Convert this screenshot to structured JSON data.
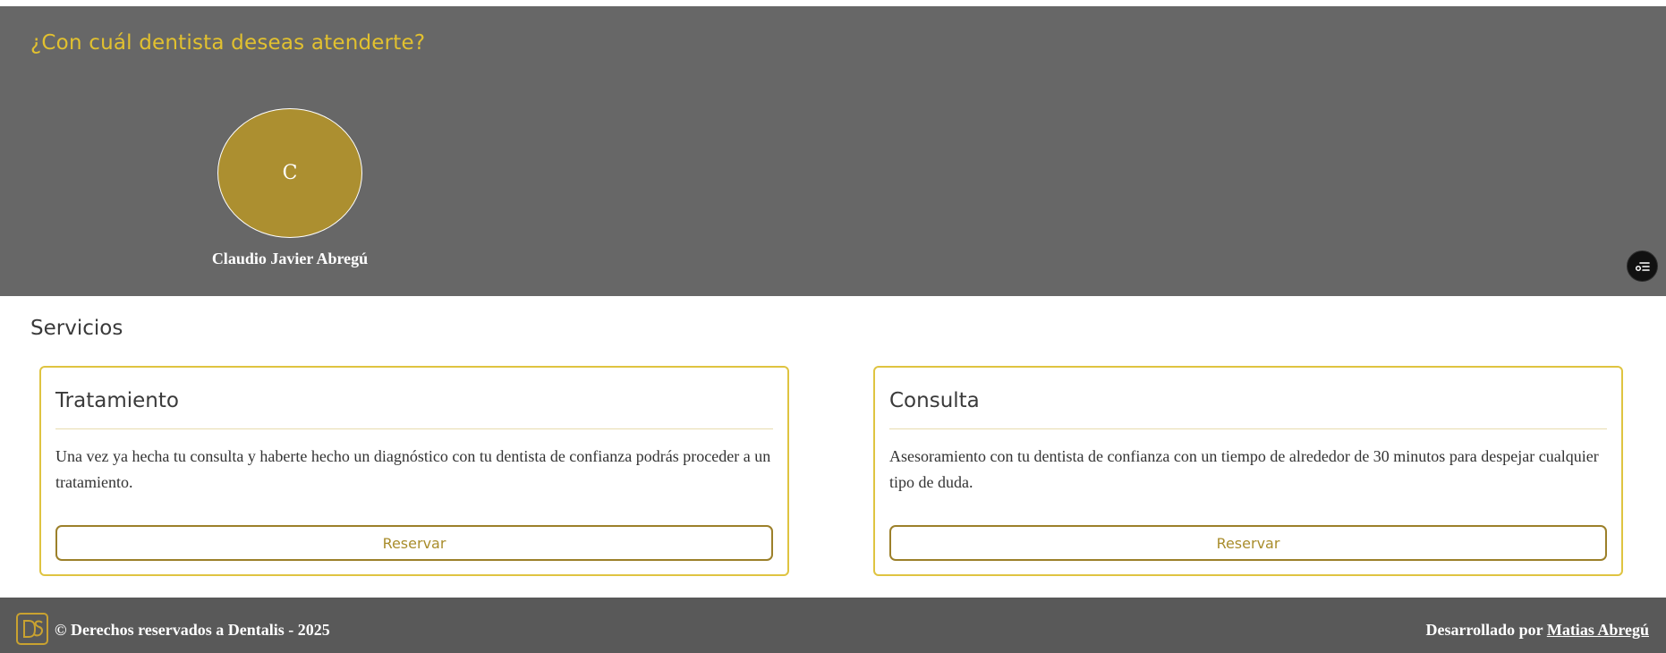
{
  "dentist_section": {
    "title": "¿Con cuál dentista deseas atenderte?",
    "dentists": [
      {
        "initial": "C",
        "name": "Claudio Javier Abregú"
      }
    ],
    "floating_button_icon": "filter-icon"
  },
  "services": {
    "title": "Servicios",
    "items": [
      {
        "name": "Tratamiento",
        "description": "Una vez ya hecha tu consulta y haberte hecho un diagnóstico con tu dentista de confianza podrás proceder a un tratamiento.",
        "button_label": "Reservar"
      },
      {
        "name": "Consulta",
        "description": "Asesoramiento con tu dentista de confianza con un tiempo de alrededor de 30 minutos para despejar cualquier tipo de duda.",
        "button_label": "Reservar"
      }
    ]
  },
  "footer": {
    "logo_icon": "dentalis-logo-icon",
    "copyright": "© Derechos reservados a Dentalis - 2025",
    "credit_prefix": "Desarrollado por",
    "credit_link": "Matias Abregú"
  },
  "colors": {
    "accent_gold": "#e2c12f",
    "avatar_gold": "#ac8f30",
    "button_gold": "#9c802a",
    "section_gray": "#676767",
    "footer_gray": "#595959"
  }
}
